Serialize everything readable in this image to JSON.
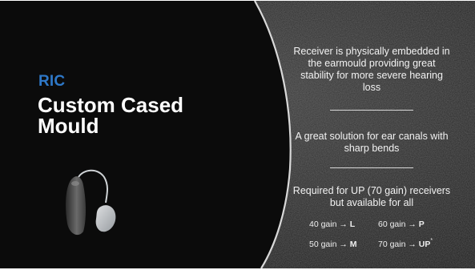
{
  "slide": {
    "eyebrow": "RIC",
    "title_line1": "Custom Cased",
    "title_line2": "Mould",
    "points": [
      "Receiver is physically embedded in the earmould providing great stability for more severe hearing loss",
      "A great solution for ear canals with sharp bends",
      "Required for UP (70 gain) receivers but available for all"
    ],
    "gains": [
      {
        "prefix": "40 gain →",
        "code": "L"
      },
      {
        "prefix": "60 gain →",
        "code": "P"
      },
      {
        "prefix": "50 gain →",
        "code": "M"
      },
      {
        "prefix": "70 gain →",
        "code": "UP",
        "mark": "*"
      }
    ]
  },
  "colors": {
    "accent": "#2e78c8",
    "left_background": "#0b0b0b",
    "right_background": "#2a2a2a",
    "text": "#ffffff"
  },
  "icons": [
    "hearing-aid-image"
  ]
}
